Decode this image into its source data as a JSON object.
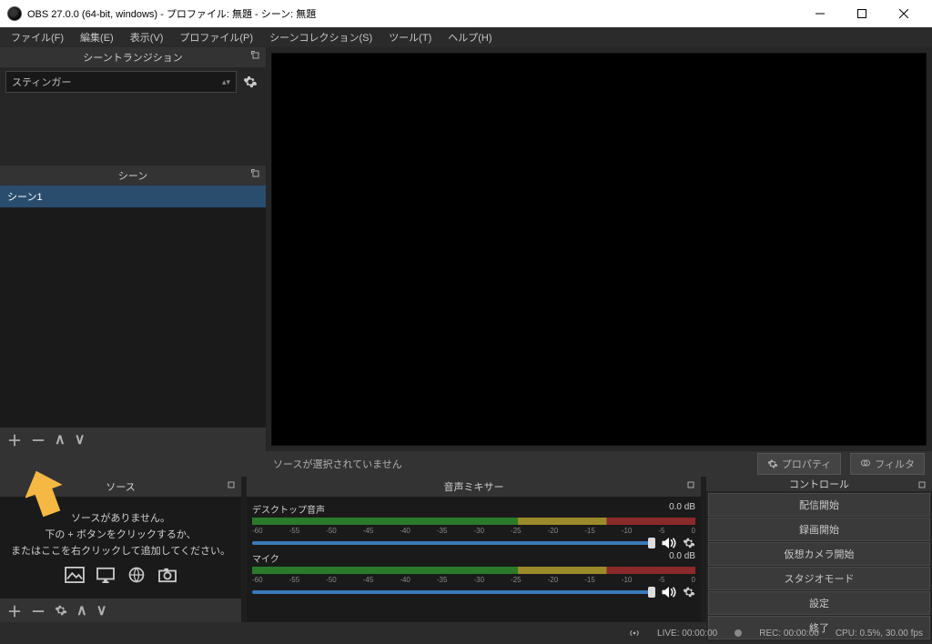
{
  "window": {
    "title": "OBS 27.0.0 (64-bit, windows) - プロファイル: 無題 - シーン: 無題"
  },
  "menu": {
    "file": "ファイル(F)",
    "edit": "編集(E)",
    "view": "表示(V)",
    "profile": "プロファイル(P)",
    "scene_collection": "シーンコレクション(S)",
    "tools": "ツール(T)",
    "help": "ヘルプ(H)"
  },
  "panels": {
    "transitions": "シーントランジション",
    "scenes": "シーン",
    "sources": "ソース",
    "mixer": "音声ミキサー",
    "controls": "コントロール"
  },
  "transitions": {
    "selected": "スティンガー"
  },
  "scenes": {
    "items": [
      "シーン1"
    ]
  },
  "sources": {
    "empty1": "ソースがありません。",
    "empty2": "下の + ボタンをクリックするか、",
    "empty3": "またはここを右クリックして追加してください。"
  },
  "sourcebar": {
    "none_selected": "ソースが選択されていません",
    "properties": "プロパティ",
    "filters": "フィルタ"
  },
  "mixer": {
    "ch1": {
      "name": "デスクトップ音声",
      "level": "0.0 dB"
    },
    "ch2": {
      "name": "マイク",
      "level": "0.0 dB"
    },
    "scale": [
      "-60",
      "-55",
      "-50",
      "-45",
      "-40",
      "-35",
      "-30",
      "-25",
      "-20",
      "-15",
      "-10",
      "-5",
      "0"
    ]
  },
  "controls": {
    "stream": "配信開始",
    "record": "録画開始",
    "vcam": "仮想カメラ開始",
    "studio": "スタジオモード",
    "settings": "設定",
    "exit": "終了"
  },
  "status": {
    "live": "LIVE: 00:00:00",
    "rec": "REC: 00:00:00",
    "cpu": "CPU: 0.5%, 30.00 fps"
  }
}
